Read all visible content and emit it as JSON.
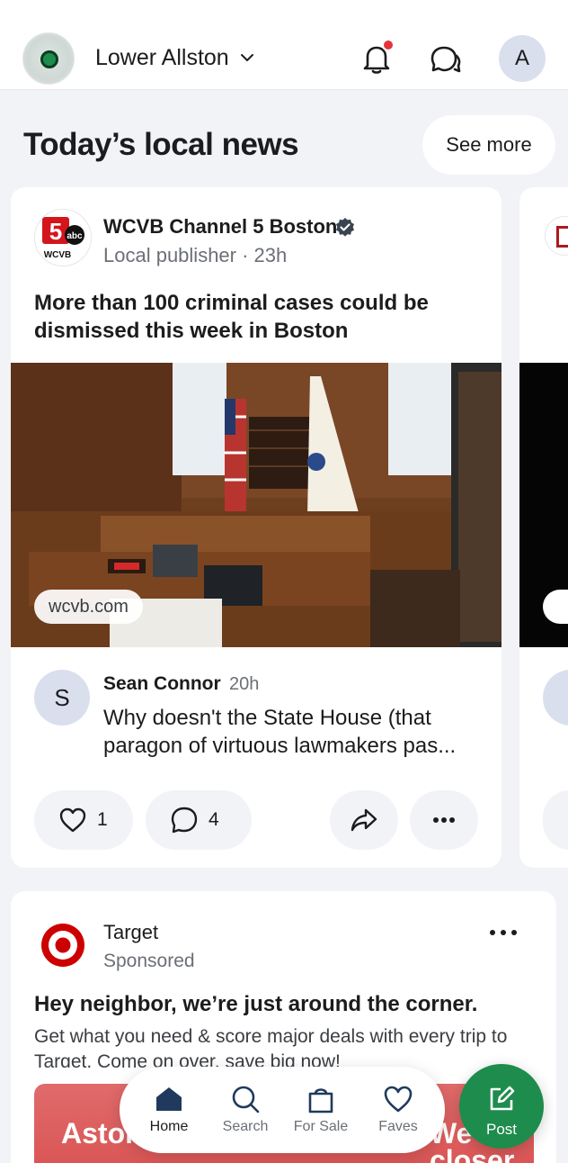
{
  "header": {
    "location": "Lower Allston",
    "user_initial": "A",
    "accent": "#1d8c4d",
    "notification_dot_color": "#e5333b"
  },
  "feed": {
    "section_title": "Today’s local news",
    "see_more": "See more",
    "news_card": {
      "publisher": "WCVB Channel 5 Boston",
      "publisher_logo_text": "WCVB",
      "publisher_logo_badge": "abc",
      "meta": "Local publisher · 23h",
      "headline": "More than 100 criminal cases could be dismissed this week in Boston",
      "source": "wcvb.com",
      "comment": {
        "avatar_initial": "S",
        "author": "Sean Connor",
        "time": "20h",
        "text": "Why doesn't the State House (that paragon of virtuous lawmakers pas..."
      },
      "likes": "1",
      "comments": "4"
    },
    "ad_card": {
      "advertiser": "Target",
      "label": "Sponsored",
      "headline": "Hey neighbor, we’re just around the corner.",
      "body": "Get what you need & score major deals with every trip to Target. Come on over, save big now!",
      "banner_left": "Aston Target is",
      "banner_right": "We closer th",
      "brand_color": "#cc0000"
    }
  },
  "nav": {
    "items": [
      {
        "label": "Home",
        "icon": "home-icon"
      },
      {
        "label": "Search",
        "icon": "search-icon"
      },
      {
        "label": "For Sale",
        "icon": "bag-icon"
      },
      {
        "label": "Faves",
        "icon": "heart-icon"
      }
    ],
    "post": "Post"
  }
}
